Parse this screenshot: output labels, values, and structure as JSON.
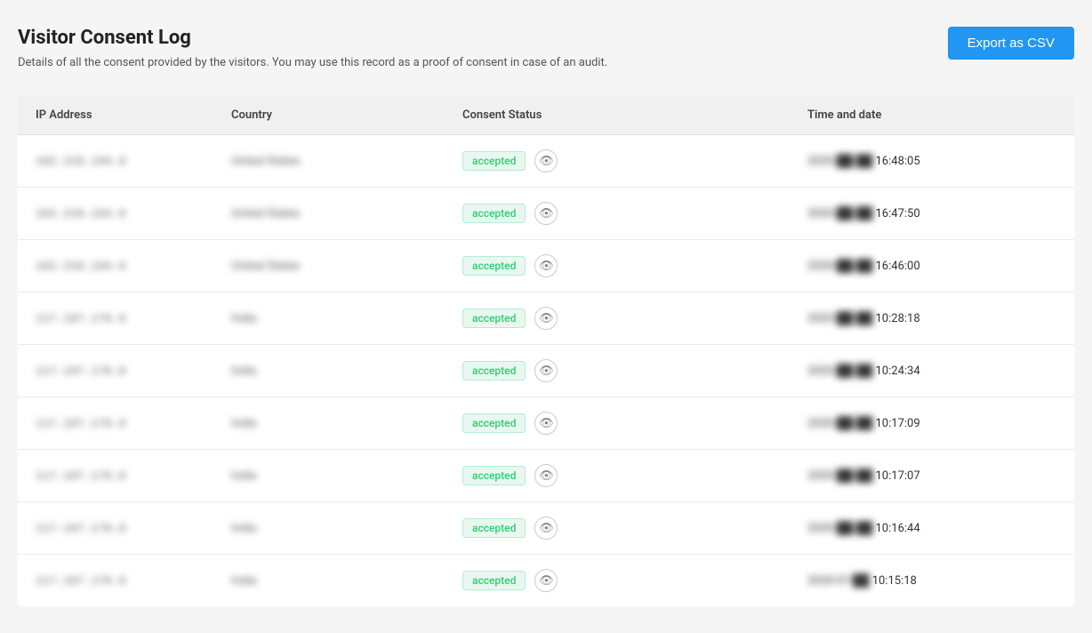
{
  "header": {
    "title": "Visitor Consent Log",
    "description": "Details of all the consent provided by the visitors. You may use this record as a proof of consent in case of an audit.",
    "export_button": "Export as CSV"
  },
  "table": {
    "columns": [
      "IP Address",
      "Country",
      "Consent Status",
      "Time and date"
    ],
    "rows": [
      {
        "ip": "162.210.194.0",
        "country": "United States",
        "status": "accepted",
        "date_blurred": "2020-██-██",
        "time": "16:48:05"
      },
      {
        "ip": "162.210.194.0",
        "country": "United States",
        "status": "accepted",
        "date_blurred": "2020-██-██",
        "time": "16:47:50"
      },
      {
        "ip": "162.210.194.0",
        "country": "United States",
        "status": "accepted",
        "date_blurred": "2020-██-██",
        "time": "16:46:00"
      },
      {
        "ip": "117.197.176.0",
        "country": "India",
        "status": "accepted",
        "date_blurred": "2020-██-██",
        "time": "10:28:18"
      },
      {
        "ip": "117.197.176.0",
        "country": "India",
        "status": "accepted",
        "date_blurred": "2020-██-██",
        "time": "10:24:34"
      },
      {
        "ip": "117.197.176.0",
        "country": "India",
        "status": "accepted",
        "date_blurred": "2020-██-██",
        "time": "10:17:09"
      },
      {
        "ip": "117.197.176.0",
        "country": "India",
        "status": "accepted",
        "date_blurred": "2020-██-██",
        "time": "10:17:07"
      },
      {
        "ip": "117.197.176.0",
        "country": "India",
        "status": "accepted",
        "date_blurred": "2020-██-██",
        "time": "10:16:44"
      },
      {
        "ip": "117.197.176.0",
        "country": "India",
        "status": "accepted",
        "date_blurred": "2020-07-██",
        "time": "10:15:18"
      }
    ],
    "status_label": "accepted",
    "eye_icon": "👁"
  }
}
